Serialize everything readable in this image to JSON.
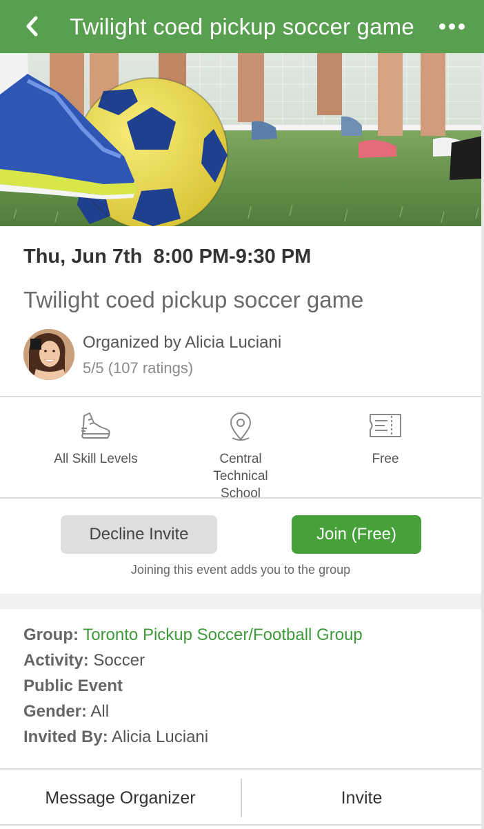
{
  "header": {
    "title": "Twilight coed pickup soccer game"
  },
  "event": {
    "datetime": "Thu, Jun 7th  8:00 PM-9:30 PM",
    "title": "Twilight coed pickup soccer game",
    "organizer": "Organized by Alicia Luciani",
    "rating": "5/5 (107 ratings)"
  },
  "features": [
    {
      "icon": "running-shoe-icon",
      "label": "All Skill Levels"
    },
    {
      "icon": "location-pin-icon",
      "label": "Central Technical School"
    },
    {
      "icon": "ticket-icon",
      "label": "Free"
    }
  ],
  "actions": {
    "decline_label": "Decline Invite",
    "join_label": "Join (Free)",
    "join_note": "Joining this event adds you to the group"
  },
  "details": {
    "group_label": "Group:",
    "group_value": "Toronto Pickup Soccer/Football Group",
    "activity_label": "Activity:",
    "activity_value": "Soccer",
    "visibility": "Public Event",
    "gender_label": "Gender:",
    "gender_value": "All",
    "invited_label": "Invited By:",
    "invited_value": "Alicia Luciani"
  },
  "bottom_bar": {
    "message_label": "Message Organizer",
    "invite_label": "Invite"
  },
  "colors": {
    "header": "#58a04f",
    "join_button": "#46a13b",
    "decline_button": "#dedede",
    "link": "#3e9a3a"
  }
}
